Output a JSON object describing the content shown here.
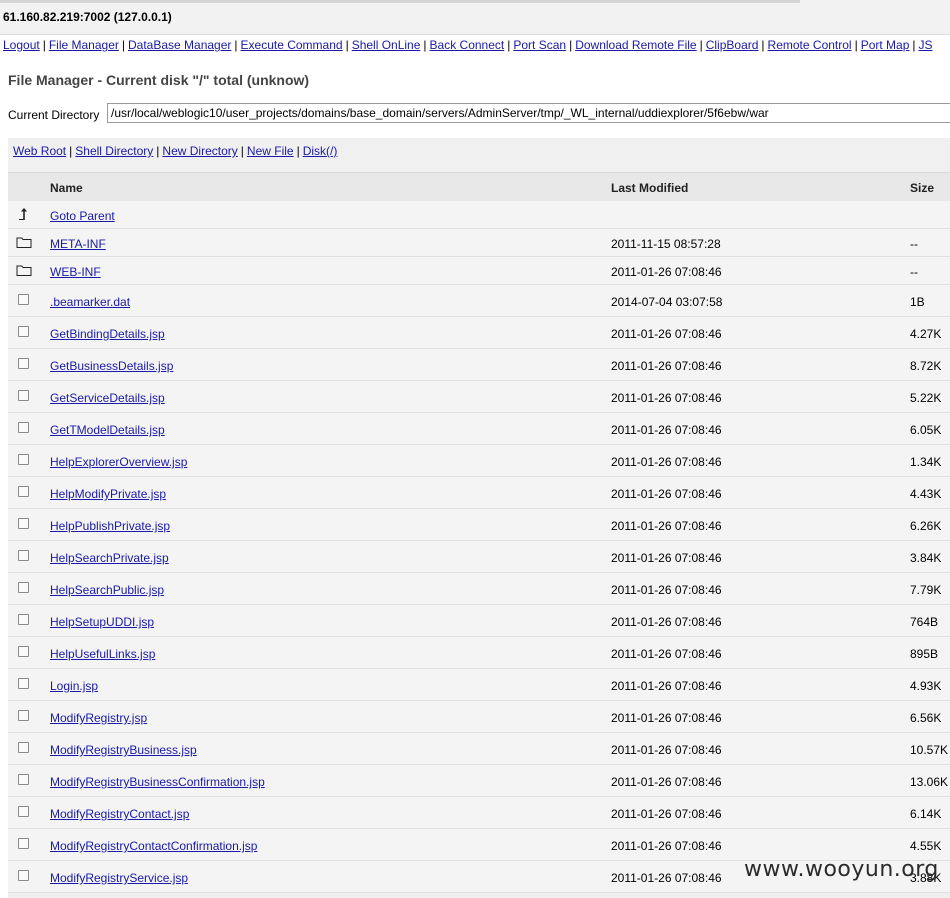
{
  "host": "61.160.82.219:7002 (127.0.0.1)",
  "nav": [
    "Logout",
    "File Manager",
    "DataBase Manager",
    "Execute Command",
    "Shell OnLine",
    "Back Connect",
    "Port Scan",
    "Download Remote File",
    "ClipBoard",
    "Remote Control",
    "Port Map",
    "JS"
  ],
  "title": "File Manager - Current disk \"/\" total (unknow)",
  "current_directory_label": "Current Directory",
  "current_directory_value": "/usr/local/weblogic10/user_projects/domains/base_domain/servers/AdminServer/tmp/_WL_internal/uddiexplorer/5f6ebw/war",
  "quick_links": [
    "Web Root",
    "Shell Directory",
    "New Directory",
    "New File",
    "Disk(/)"
  ],
  "columns": {
    "name": "Name",
    "modified": "Last Modified",
    "size": "Size"
  },
  "goto_parent": "Goto Parent",
  "folders": [
    {
      "name": "META-INF",
      "modified": "2011-11-15 08:57:28",
      "size": "--"
    },
    {
      "name": "WEB-INF",
      "modified": "2011-01-26 07:08:46",
      "size": "--"
    }
  ],
  "files": [
    {
      "name": ".beamarker.dat",
      "modified": "2014-07-04 03:07:58",
      "size": "1B"
    },
    {
      "name": "GetBindingDetails.jsp",
      "modified": "2011-01-26 07:08:46",
      "size": "4.27K"
    },
    {
      "name": "GetBusinessDetails.jsp",
      "modified": "2011-01-26 07:08:46",
      "size": "8.72K"
    },
    {
      "name": "GetServiceDetails.jsp",
      "modified": "2011-01-26 07:08:46",
      "size": "5.22K"
    },
    {
      "name": "GetTModelDetails.jsp",
      "modified": "2011-01-26 07:08:46",
      "size": "6.05K"
    },
    {
      "name": "HelpExplorerOverview.jsp",
      "modified": "2011-01-26 07:08:46",
      "size": "1.34K"
    },
    {
      "name": "HelpModifyPrivate.jsp",
      "modified": "2011-01-26 07:08:46",
      "size": "4.43K"
    },
    {
      "name": "HelpPublishPrivate.jsp",
      "modified": "2011-01-26 07:08:46",
      "size": "6.26K"
    },
    {
      "name": "HelpSearchPrivate.jsp",
      "modified": "2011-01-26 07:08:46",
      "size": "3.84K"
    },
    {
      "name": "HelpSearchPublic.jsp",
      "modified": "2011-01-26 07:08:46",
      "size": "7.79K"
    },
    {
      "name": "HelpSetupUDDI.jsp",
      "modified": "2011-01-26 07:08:46",
      "size": "764B"
    },
    {
      "name": "HelpUsefulLinks.jsp",
      "modified": "2011-01-26 07:08:46",
      "size": "895B"
    },
    {
      "name": "Login.jsp",
      "modified": "2011-01-26 07:08:46",
      "size": "4.93K"
    },
    {
      "name": "ModifyRegistry.jsp",
      "modified": "2011-01-26 07:08:46",
      "size": "6.56K"
    },
    {
      "name": "ModifyRegistryBusiness.jsp",
      "modified": "2011-01-26 07:08:46",
      "size": "10.57K"
    },
    {
      "name": "ModifyRegistryBusinessConfirmation.jsp",
      "modified": "2011-01-26 07:08:46",
      "size": "13.06K"
    },
    {
      "name": "ModifyRegistryContact.jsp",
      "modified": "2011-01-26 07:08:46",
      "size": "6.14K"
    },
    {
      "name": "ModifyRegistryContactConfirmation.jsp",
      "modified": "2011-01-26 07:08:46",
      "size": "4.55K"
    },
    {
      "name": "ModifyRegistryService.jsp",
      "modified": "2011-01-26 07:08:46",
      "size": "3.88K"
    }
  ],
  "watermark": "www.wooyun.org",
  "icons": {
    "parent": "up-arrow-icon",
    "folder": "folder-icon"
  }
}
